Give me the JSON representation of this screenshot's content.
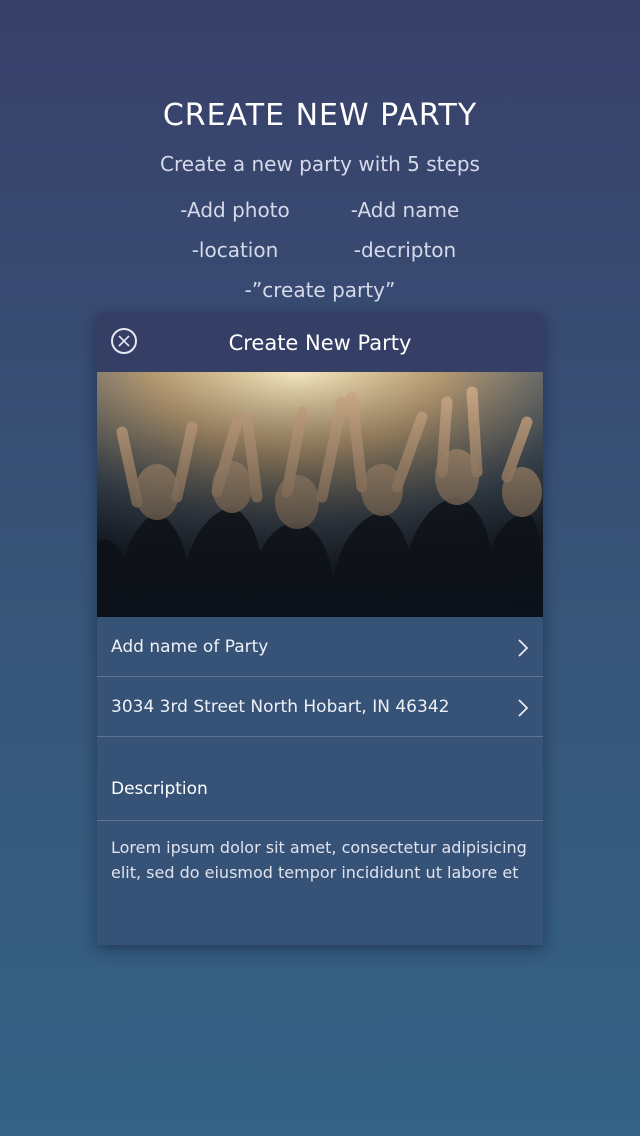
{
  "intro": {
    "title": "CREATE NEW PARTY",
    "subtitle": "Create a new party with 5 steps",
    "steps": {
      "step1": "-Add photo",
      "step2": "-Add name",
      "step3": "-location",
      "step4": "-decripton",
      "step5": "-”create party”"
    }
  },
  "card": {
    "title": "Create New Party",
    "close_icon": "close-circle-icon",
    "photo_icon": "party-crowd-photo",
    "name_row": {
      "label": "Add name of Party",
      "icon": "chevron-right-icon"
    },
    "location_row": {
      "label": "3034 3rd Street North Hobart, IN 46342",
      "icon": "chevron-right-icon"
    },
    "description": {
      "heading": "Description",
      "text": "Lorem ipsum dolor sit amet, consectetur adipisicing elit, sed do eiusmod tempor incididunt ut labore et"
    }
  },
  "colors": {
    "background_top": "#39406a",
    "background_bottom": "#346184",
    "card": "#375277",
    "card_header": "#353e64"
  }
}
